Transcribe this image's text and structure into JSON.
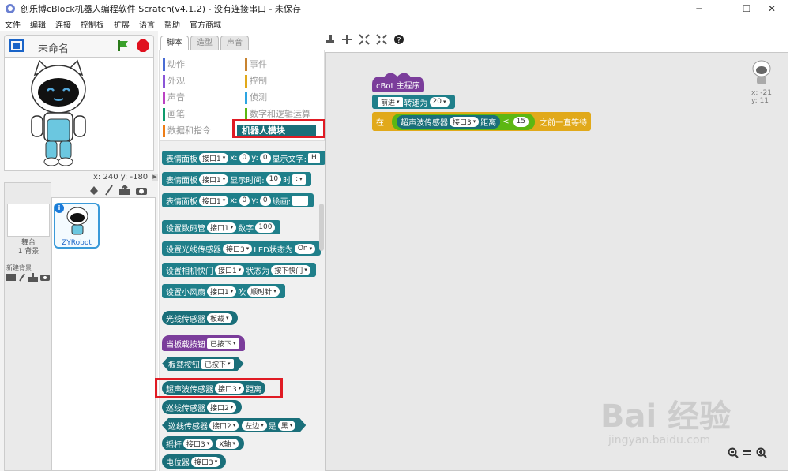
{
  "window": {
    "title": "创乐博cBlock机器人编程软件 Scratch(v4.1.2) - 没有连接串口 - 未保存"
  },
  "menu": [
    "文件",
    "编辑",
    "连接",
    "控制板",
    "扩展",
    "语言",
    "帮助",
    "官方商城"
  ],
  "stage": {
    "name": "未命名",
    "coords": "x: 240  y: -180"
  },
  "sprites": {
    "stage_label": "舞台",
    "stage_bg": "1 背景",
    "new_bg": "新建背景",
    "sprite_name": "ZYRobot"
  },
  "tabs": [
    "脚本",
    "造型",
    "声音"
  ],
  "categories": [
    {
      "name": "动作",
      "color": "#4a6cd4"
    },
    {
      "name": "事件",
      "color": "#c88330"
    },
    {
      "name": "外观",
      "color": "#8a55d7"
    },
    {
      "name": "控制",
      "color": "#e1a91a"
    },
    {
      "name": "声音",
      "color": "#bb42c3"
    },
    {
      "name": "侦测",
      "color": "#2ca5e2"
    },
    {
      "name": "画笔",
      "color": "#0e9a6c"
    },
    {
      "name": "数字和逻辑运算",
      "color": "#5cb712"
    },
    {
      "name": "数据和指令",
      "color": "#ee7d16"
    },
    {
      "name": "机器人模块",
      "color": "#1a6f7a"
    }
  ],
  "palette_blocks": {
    "b1": {
      "a": "表情面板",
      "s1": "接口1",
      "b": "x:",
      "s2": "0",
      "c": "y:",
      "s3": "0",
      "d": "显示文字:",
      "s4": "H"
    },
    "b2": {
      "a": "表情面板",
      "s1": "接口1",
      "b": "显示时间:",
      "s2": "10",
      "c": "时",
      "s3": ":"
    },
    "b3": {
      "a": "表情面板",
      "s1": "接口1",
      "b": "x:",
      "s2": "0",
      "c": "y:",
      "s3": "0",
      "d": "绘画:"
    },
    "b4": {
      "a": "设置数码管",
      "s1": "接口1",
      "b": "数字",
      "s2": "100"
    },
    "b5": {
      "a": "设置光线传感器",
      "s1": "接口3",
      "b": "LED状态为",
      "s2": "On"
    },
    "b6": {
      "a": "设置相机快门",
      "s1": "接口1",
      "b": "状态为",
      "s2": "按下快门"
    },
    "b7": {
      "a": "设置小风扇",
      "s1": "接口1",
      "b": "吹",
      "s2": "顺时针"
    },
    "b8": {
      "a": "光线传感器",
      "s1": "板载"
    },
    "b9": {
      "a": "当板载按钮",
      "s1": "已按下"
    },
    "b10": {
      "a": "板载按钮",
      "s1": "已按下"
    },
    "b11": {
      "a": "超声波传感器",
      "s1": "接口3",
      "b": "距离"
    },
    "b12": {
      "a": "巡线传感器",
      "s1": "接口2"
    },
    "b13": {
      "a": "巡线传感器",
      "s1": "接口2",
      "s2": "左边",
      "b": "是",
      "s3": "黑"
    },
    "b14": {
      "a": "摇杆",
      "s1": "接口3",
      "s2": "X轴"
    },
    "b15": {
      "a": "电位器",
      "s1": "接口3"
    }
  },
  "script": {
    "hat": "cBot 主程序",
    "move": {
      "dir": "前进",
      "label": "转速为",
      "speed": "20"
    },
    "wait": {
      "pre": "在",
      "sensor": "超声波传感器",
      "port": "接口3",
      "dist": "距离",
      "op": "<",
      "val": "15",
      "post": "之前一直等待"
    }
  },
  "sprite_info": {
    "x": "x: -21",
    "y": "y: 11"
  },
  "watermark": {
    "brand": "Bai 经验",
    "url": "jingyan.baidu.com"
  }
}
